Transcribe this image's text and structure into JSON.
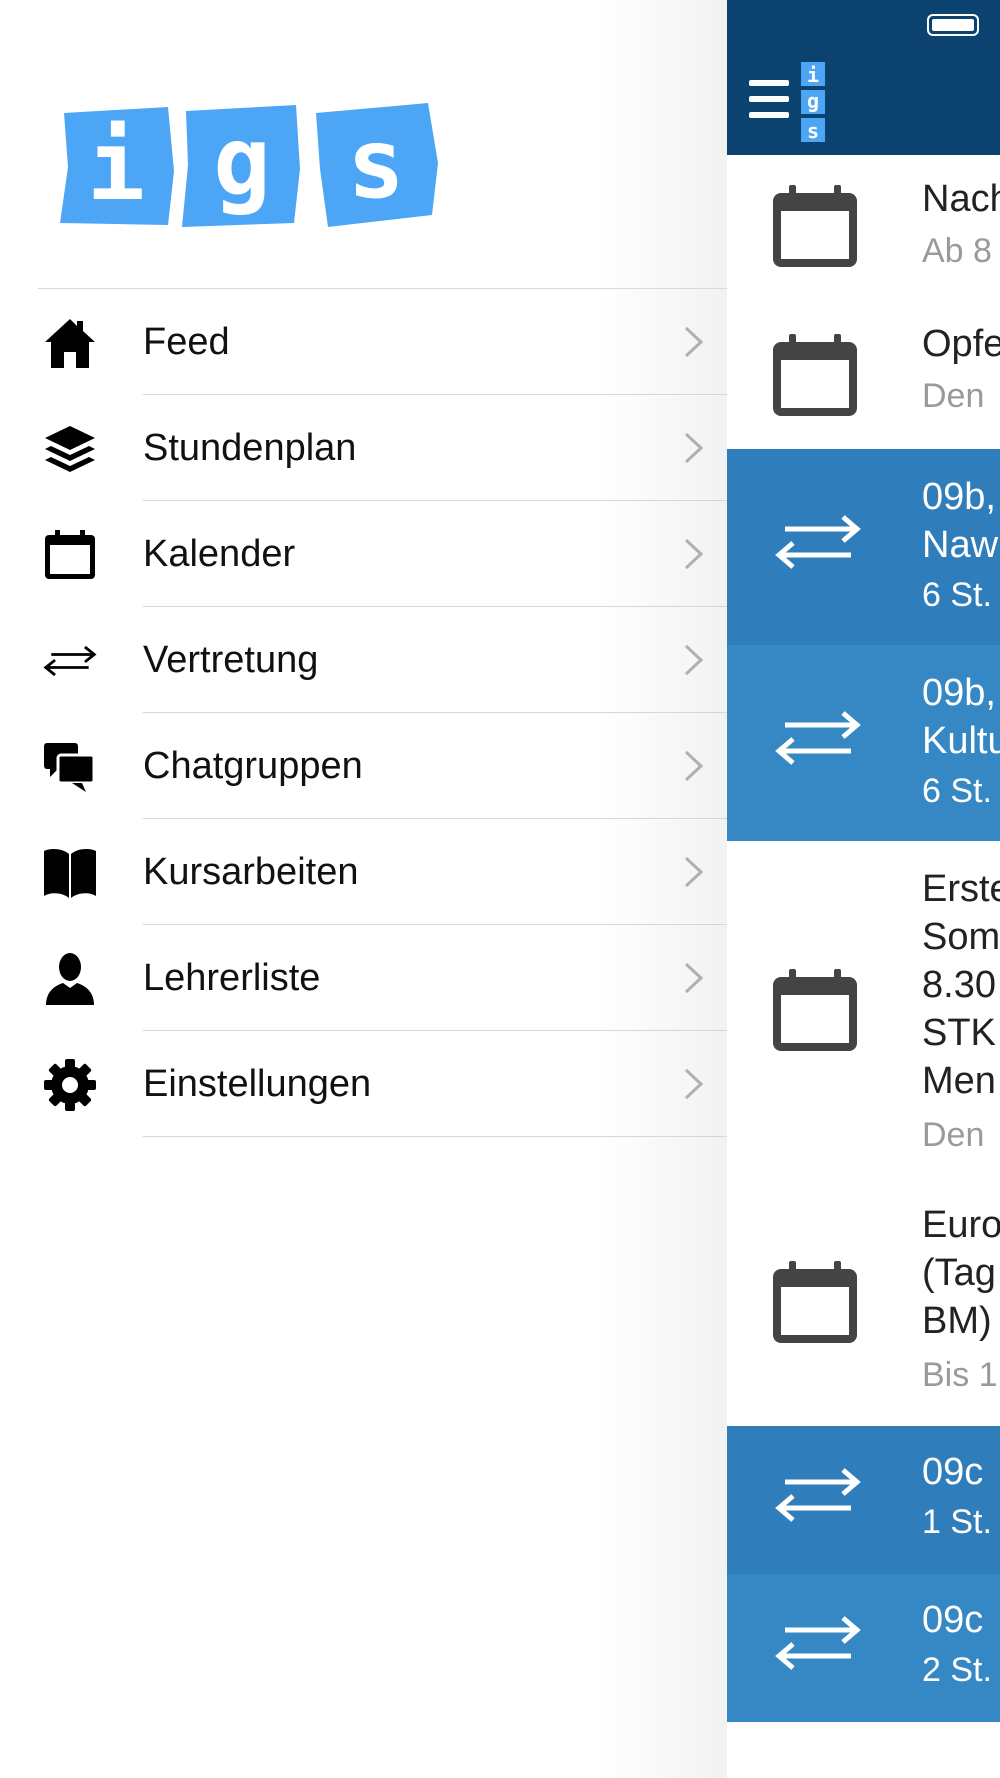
{
  "logo": {
    "letters": [
      "i",
      "g",
      "s"
    ],
    "color": "#4da6f5"
  },
  "menu": [
    {
      "label": "Feed",
      "icon": "home-icon"
    },
    {
      "label": "Stundenplan",
      "icon": "layers-icon"
    },
    {
      "label": "Kalender",
      "icon": "calendar-icon"
    },
    {
      "label": "Vertretung",
      "icon": "swap-arrows-icon"
    },
    {
      "label": "Chatgruppen",
      "icon": "chat-bubbles-icon"
    },
    {
      "label": "Kursarbeiten",
      "icon": "book-icon"
    },
    {
      "label": "Lehrerliste",
      "icon": "person-icon"
    },
    {
      "label": "Einstellungen",
      "icon": "gear-icon"
    }
  ],
  "main": {
    "header_color": "#0b426f",
    "mini_logo_letters": [
      "i",
      "g",
      "s"
    ],
    "rows": [
      {
        "type": "calendar",
        "style": "white",
        "lines": [
          "Nach"
        ],
        "sub": "Ab 8"
      },
      {
        "type": "calendar",
        "style": "white",
        "lines": [
          "Opfe"
        ],
        "sub": "Den"
      },
      {
        "type": "substitution",
        "style": "blue1",
        "lines": [
          "09b,",
          "Naw"
        ],
        "sub": "6 St."
      },
      {
        "type": "substitution",
        "style": "blue2",
        "lines": [
          "09b,",
          "Kultu"
        ],
        "sub": "6 St."
      },
      {
        "type": "calendar",
        "style": "white",
        "lines": [
          "Erste",
          "Som",
          "8.30",
          "STK",
          "Men"
        ],
        "sub": "Den"
      },
      {
        "type": "calendar",
        "style": "white",
        "lines": [
          "Euro",
          "(Tag",
          "BM)"
        ],
        "sub": "Bis 1"
      },
      {
        "type": "substitution",
        "style": "blue1",
        "lines": [
          "09c"
        ],
        "sub": "1 St."
      },
      {
        "type": "substitution",
        "style": "blue2",
        "lines": [
          "09c"
        ],
        "sub": "2 St."
      }
    ]
  }
}
